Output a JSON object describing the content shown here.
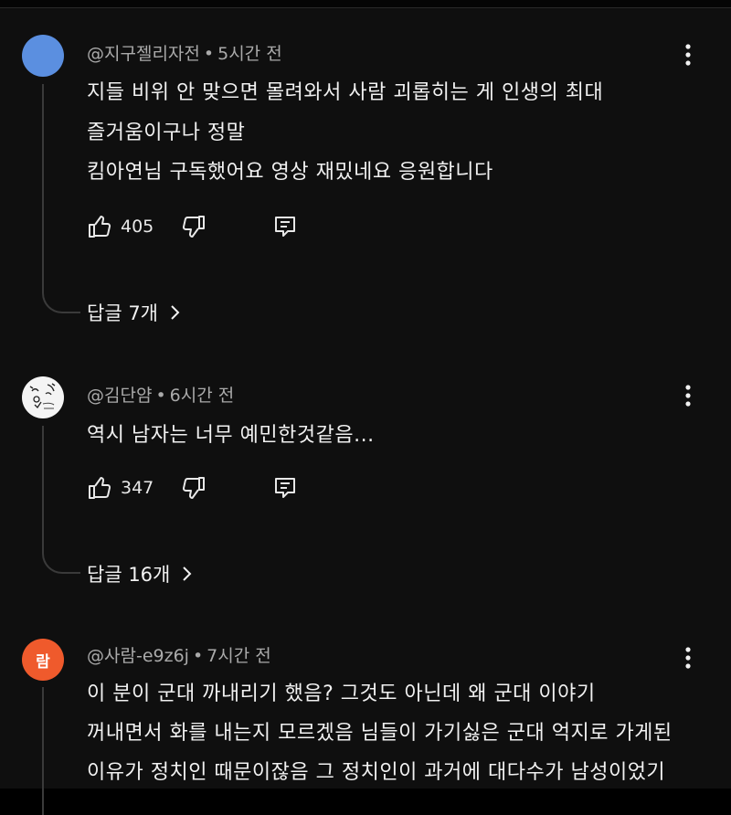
{
  "comments": [
    {
      "author": "@지구젤리자전",
      "time": "5시간 전",
      "avatar_color": "#5b8fe0",
      "lines": [
        "지들 비위 안 맞으면 몰려와서 사람 괴롭히는 게 인생의 최대",
        "즐거움이구나 정말",
        "킴아연님 구독했어요 영상 재밌네요 응원합니다"
      ],
      "likes": "405",
      "replies": "답글 7개"
    },
    {
      "author": "@김단얌",
      "time": "6시간 전",
      "lines": [
        "역시 남자는 너무 예민한것같음..."
      ],
      "likes": "347",
      "replies": "답글 16개"
    },
    {
      "author": "@사람-e9z6j",
      "time": "7시간 전",
      "avatar_text": "람",
      "avatar_color": "#ef5a2c",
      "lines": [
        "이 분이 군대 까내리기 했음? 그것도 아닌데 왜 군대 이야기",
        "꺼내면서 화를 내는지 모르겠음 님들이 가기싫은 군대 억지로 가게된",
        "이유가 정치인 때문이잖음 그 정치인이 과거에 대다수가 남성이었기"
      ]
    }
  ],
  "separator": "•",
  "icons": {
    "like": "thumbs-up-icon",
    "dislike": "thumbs-down-icon",
    "reply": "reply-comment-icon",
    "more": "more-vert-icon",
    "chevron": "chevron-right-icon"
  }
}
